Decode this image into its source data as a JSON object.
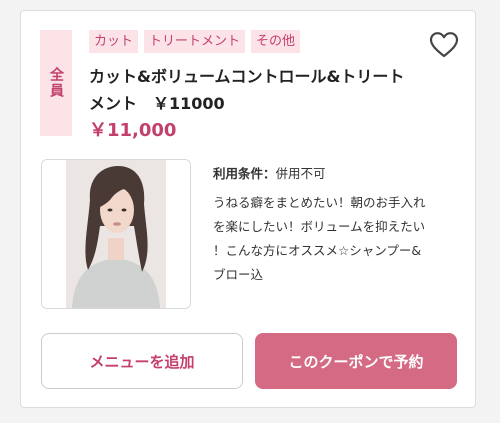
{
  "coupon": {
    "target_badge": "全員",
    "tags": [
      "カット",
      "トリートメント",
      "その他"
    ],
    "title_line1": "カット&ボリュームコントロール&トリート",
    "title_line2": "メント　￥11000",
    "price": "￥11,000",
    "conditions_label": "利用条件：",
    "conditions_value": "併用不可",
    "description_lines": [
      "うねる癖をまとめたい！朝のお手入れ",
      "を楽にしたい！ボリュームを抑えたい",
      "！こんな方にオススメ☆シャンプー&",
      "ブロー込"
    ],
    "favorite_icon": "heart-outline-icon",
    "photo": "stylist-model-photo"
  },
  "actions": {
    "add_menu_label": "メニューを追加",
    "reserve_label": "このクーポンで予約"
  },
  "colors": {
    "accent": "#c4406c",
    "tag_bg": "#fbe3e8",
    "reserve_bg": "#d46a83"
  }
}
